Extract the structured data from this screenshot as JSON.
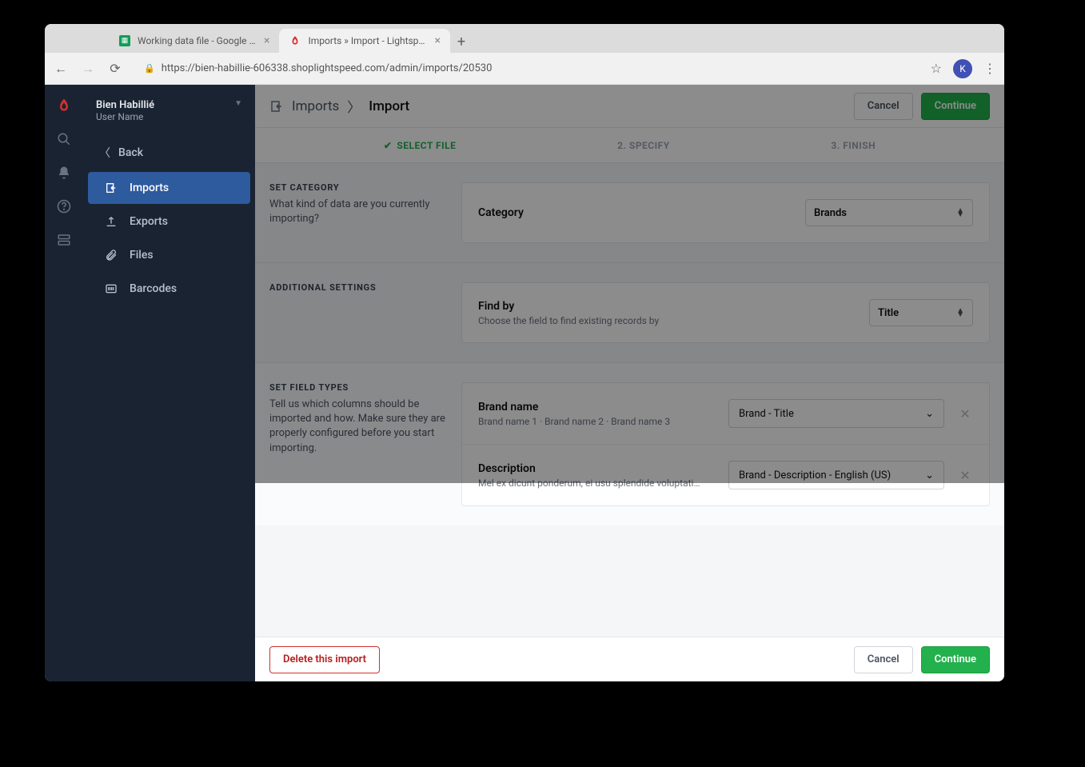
{
  "browser": {
    "tabs": [
      {
        "title": "Working data file - Google She",
        "favicon": "sheets"
      },
      {
        "title": "Imports » Import - Lightspeed",
        "favicon": "lightspeed",
        "active": true
      }
    ],
    "url": "https://bien-habillie-606338.shoplightspeed.com/admin/imports/20530",
    "avatar_initial": "K"
  },
  "store": {
    "name": "Bien Habillié",
    "user": "User Name"
  },
  "sidebar": {
    "back": "Back",
    "items": [
      {
        "label": "Imports",
        "active": true
      },
      {
        "label": "Exports"
      },
      {
        "label": "Files"
      },
      {
        "label": "Barcodes"
      }
    ]
  },
  "breadcrumb": {
    "root": "Imports",
    "current": "Import"
  },
  "buttons": {
    "cancel": "Cancel",
    "continue": "Continue",
    "delete": "Delete this import"
  },
  "steps": {
    "s1": "SELECT FILE",
    "s2": "2. SPECIFY",
    "s3": "3. FINISH"
  },
  "sections": {
    "category": {
      "title": "SET CATEGORY",
      "desc": "What kind of data are you currently importing?",
      "label": "Category",
      "value": "Brands"
    },
    "additional": {
      "title": "ADDITIONAL SETTINGS",
      "label": "Find by",
      "sublabel": "Choose the field to find existing records by",
      "value": "Title"
    },
    "fields": {
      "title": "SET FIELD TYPES",
      "desc": "Tell us which columns should be imported and how. Make sure they are properly configured before you start importing.",
      "rows": [
        {
          "name": "Brand name",
          "sample": "Brand name 1 · Brand name 2 · Brand name 3",
          "mapping": "Brand - Title"
        },
        {
          "name": "Description",
          "sample": "Mel ex dicunt ponderum, ei usu splendide voluptati…",
          "mapping": "Brand - Description - English (US)"
        }
      ]
    }
  }
}
